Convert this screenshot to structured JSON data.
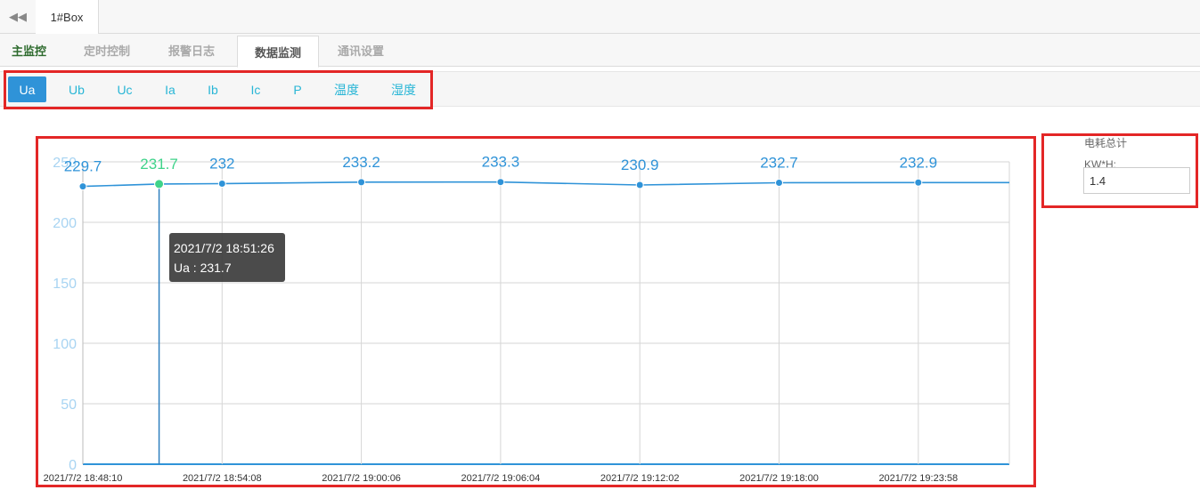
{
  "header": {
    "box_tab": "1#Box"
  },
  "nav": {
    "items": [
      {
        "label": "主监控"
      },
      {
        "label": "定时控制"
      },
      {
        "label": "报警日志"
      },
      {
        "label": "数据监测"
      },
      {
        "label": "通讯设置"
      }
    ],
    "active_index": 3
  },
  "subtabs": {
    "items": [
      "Ua",
      "Ub",
      "Uc",
      "Ia",
      "Ib",
      "Ic",
      "P",
      "温度",
      "湿度"
    ],
    "active_index": 0
  },
  "side": {
    "title": "电耗总计",
    "label": "KW*H:",
    "value": "1.4"
  },
  "tooltip": {
    "time": "2021/7/2 18:51:26",
    "text": "Ua : 231.7"
  },
  "colors": {
    "line": "#2f93d8",
    "highlight": "#3fd38a",
    "axis_label": "#a8d4f2",
    "red_frame": "#e32626"
  },
  "icons": {
    "back": "double-left-chevron-icon"
  },
  "chart_data": {
    "type": "line",
    "series": [
      {
        "name": "Ua"
      }
    ],
    "ylim": [
      0,
      250
    ],
    "yticks": [
      0,
      50,
      100,
      150,
      200,
      250
    ],
    "xtick_labels": [
      "2021/7/2 18:48:10",
      "2021/7/2 18:54:08",
      "2021/7/2 19:00:06",
      "2021/7/2 19:06:04",
      "2021/7/2 19:12:02",
      "2021/7/2 19:18:00",
      "2021/7/2 19:23:58"
    ],
    "points": [
      {
        "x": "2021/7/2 18:48:10",
        "y": 229.7
      },
      {
        "x": "2021/7/2 18:51:26",
        "y": 231.7
      },
      {
        "x": "2021/7/2 18:54:08",
        "y": 232
      },
      {
        "x": "2021/7/2 19:00:06",
        "y": 233.2
      },
      {
        "x": "2021/7/2 19:06:04",
        "y": 233.3
      },
      {
        "x": "2021/7/2 19:12:02",
        "y": 230.9
      },
      {
        "x": "2021/7/2 19:18:00",
        "y": 232.7
      },
      {
        "x": "2021/7/2 19:23:58",
        "y": 232.9
      }
    ],
    "highlight_index": 1,
    "grid": true
  }
}
